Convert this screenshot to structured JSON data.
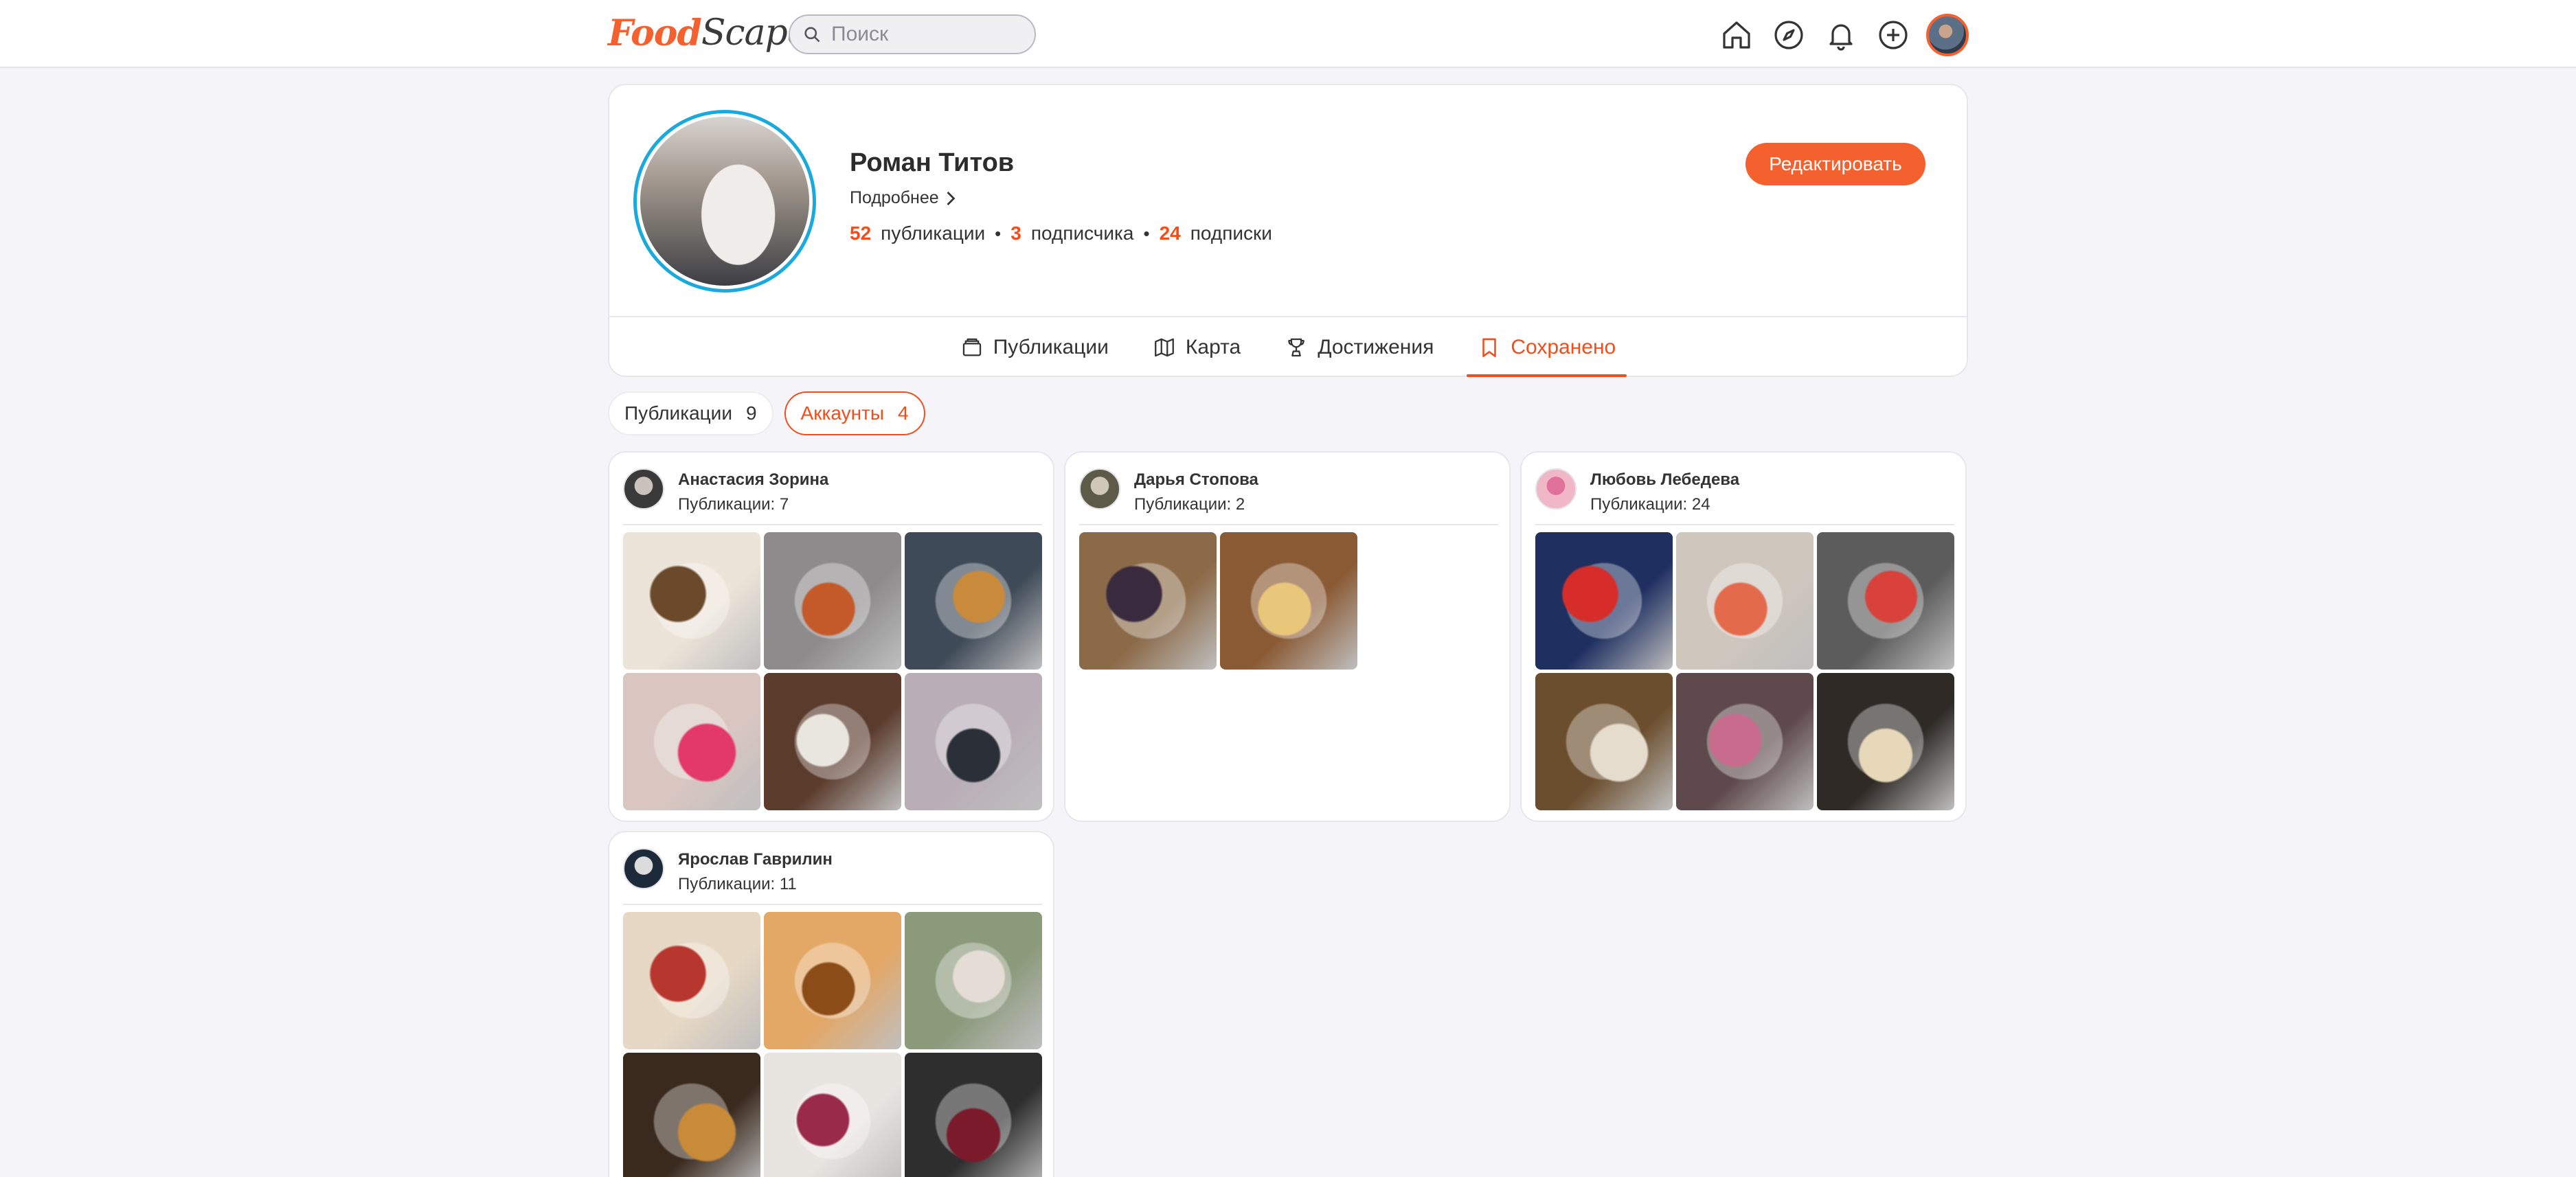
{
  "header": {
    "logo_food": "Food",
    "logo_scape": "Scape",
    "search_placeholder": "Поиск",
    "search_value": "",
    "icons": [
      "home-icon",
      "explore-icon",
      "notifications-icon",
      "add-icon",
      "avatar"
    ]
  },
  "profile": {
    "name": "Роман Титов",
    "more_label": "Подробнее",
    "publications_count": "52",
    "publications_label": "публикации",
    "followers_count": "3",
    "followers_label": "подписчика",
    "following_count": "24",
    "following_label": "подписки",
    "edit_label": "Редактировать"
  },
  "tabs": [
    {
      "label": "Публикации",
      "icon": "tray-icon",
      "active": false
    },
    {
      "label": "Карта",
      "icon": "map-icon",
      "active": false
    },
    {
      "label": "Достижения",
      "icon": "trophy-icon",
      "active": false
    },
    {
      "label": "Сохранено",
      "icon": "bookmark-icon",
      "active": true
    }
  ],
  "chips": [
    {
      "label": "Публикации",
      "count": "9",
      "active": false
    },
    {
      "label": "Аккаунты",
      "count": "4",
      "active": true
    }
  ],
  "accounts": [
    {
      "name": "Анастасия Зорина",
      "publications": "Публикации: 7",
      "avatar_colors": [
        "#3b3a3a",
        "#c9c2bd"
      ],
      "photos": [
        [
          "#ece4d8",
          "#6b4a2c"
        ],
        [
          "#8d8b8c",
          "#c45a2a"
        ],
        [
          "#3e4a57",
          "#c98a3c"
        ],
        [
          "#d9c6c0",
          "#e2386a"
        ],
        [
          "#5a3b2c",
          "#e9e5df"
        ],
        [
          "#b9aeb7",
          "#2a2f38"
        ]
      ]
    },
    {
      "name": "Дарья Стопова",
      "publications": "Публикации: 2",
      "avatar_colors": [
        "#5d5a4a",
        "#cfc7b8"
      ],
      "photos": [
        [
          "#8b6a48",
          "#3a2a3e"
        ],
        [
          "#8a5a34",
          "#e9c77a"
        ]
      ]
    },
    {
      "name": "Любовь Лебедева",
      "publications": "Публикации: 24",
      "avatar_colors": [
        "#f0b7c6",
        "#e0719a"
      ],
      "photos": [
        [
          "#1e2f60",
          "#d72d2a"
        ],
        [
          "#cfc6bd",
          "#e46a4c"
        ],
        [
          "#5c5c5c",
          "#d8423a"
        ],
        [
          "#6b4e2e",
          "#e6dccd"
        ],
        [
          "#5e4a4c",
          "#c96b8d"
        ],
        [
          "#2f2a26",
          "#e6d8b8"
        ]
      ]
    },
    {
      "name": "Ярослав Гаврилин",
      "publications": "Публикации: 11",
      "avatar_colors": [
        "#1c2a3a",
        "#dcdcdc"
      ],
      "photos": [
        [
          "#e6d8c4",
          "#b7362e"
        ],
        [
          "#e3a766",
          "#8c4c18"
        ],
        [
          "#8c9a7c",
          "#e5ddd5"
        ],
        [
          "#3a2a1e",
          "#c98a3a"
        ],
        [
          "#e8e4e0",
          "#9a2a4a"
        ],
        [
          "#2e2e2e",
          "#7a1a2a"
        ]
      ]
    }
  ]
}
